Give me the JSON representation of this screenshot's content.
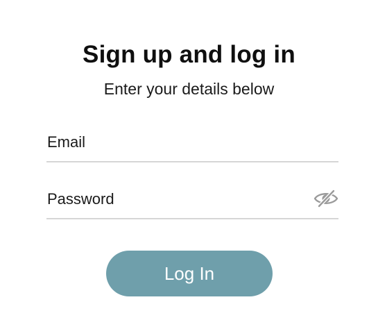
{
  "header": {
    "title": "Sign up and log in",
    "subtitle": "Enter your details below"
  },
  "form": {
    "email": {
      "placeholder": "Email",
      "value": ""
    },
    "password": {
      "placeholder": "Password",
      "value": "",
      "toggle_icon": "eye-slash-icon"
    }
  },
  "actions": {
    "login_label": "Log In"
  },
  "colors": {
    "button_bg": "#6f9fab",
    "divider": "#d6d6d6",
    "icon": "#9a9a9a"
  }
}
